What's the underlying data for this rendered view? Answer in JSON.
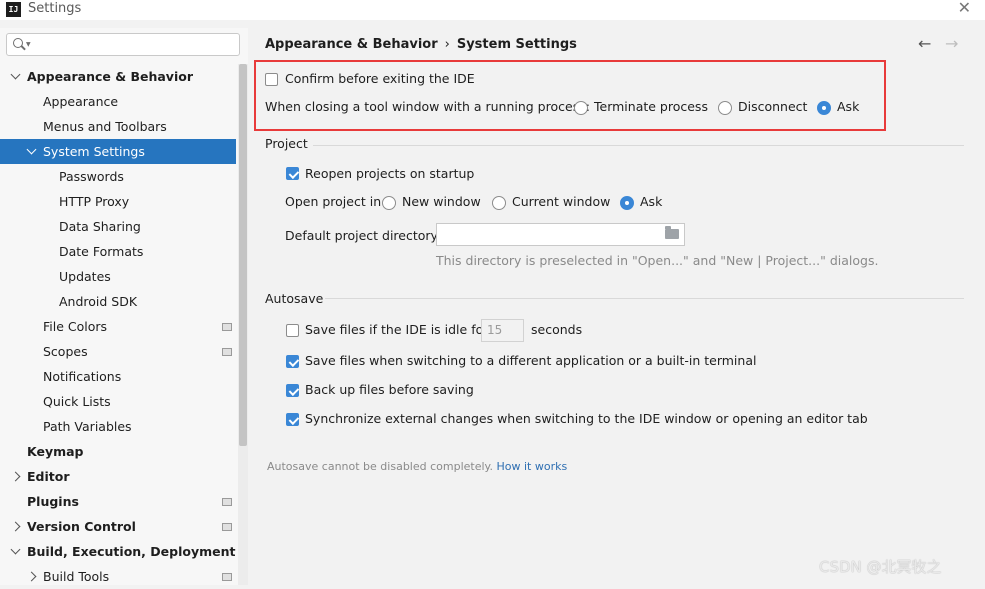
{
  "window": {
    "title": "Settings",
    "app_icon_label": "IJ"
  },
  "search": {
    "value": "",
    "placeholder": ""
  },
  "sidebar": {
    "items": [
      {
        "label": "Appearance & Behavior",
        "level": 0,
        "bold": true,
        "expanded": true,
        "selected": false,
        "project_icon": false
      },
      {
        "label": "Appearance",
        "level": 1,
        "bold": false,
        "selected": false,
        "project_icon": false
      },
      {
        "label": "Menus and Toolbars",
        "level": 1,
        "bold": false,
        "selected": false,
        "project_icon": false
      },
      {
        "label": "System Settings",
        "level": 1,
        "bold": false,
        "expanded": true,
        "selected": true,
        "project_icon": false
      },
      {
        "label": "Passwords",
        "level": 2,
        "bold": false,
        "selected": false,
        "project_icon": false
      },
      {
        "label": "HTTP Proxy",
        "level": 2,
        "bold": false,
        "selected": false,
        "project_icon": false
      },
      {
        "label": "Data Sharing",
        "level": 2,
        "bold": false,
        "selected": false,
        "project_icon": false
      },
      {
        "label": "Date Formats",
        "level": 2,
        "bold": false,
        "selected": false,
        "project_icon": false
      },
      {
        "label": "Updates",
        "level": 2,
        "bold": false,
        "selected": false,
        "project_icon": false
      },
      {
        "label": "Android SDK",
        "level": 2,
        "bold": false,
        "selected": false,
        "project_icon": false
      },
      {
        "label": "File Colors",
        "level": 1,
        "bold": false,
        "selected": false,
        "project_icon": true
      },
      {
        "label": "Scopes",
        "level": 1,
        "bold": false,
        "selected": false,
        "project_icon": true
      },
      {
        "label": "Notifications",
        "level": 1,
        "bold": false,
        "selected": false,
        "project_icon": false
      },
      {
        "label": "Quick Lists",
        "level": 1,
        "bold": false,
        "selected": false,
        "project_icon": false
      },
      {
        "label": "Path Variables",
        "level": 1,
        "bold": false,
        "selected": false,
        "project_icon": false
      },
      {
        "label": "Keymap",
        "level": 0,
        "bold": true,
        "selected": false,
        "project_icon": false
      },
      {
        "label": "Editor",
        "level": 0,
        "bold": true,
        "expanded": false,
        "selected": false,
        "project_icon": false
      },
      {
        "label": "Plugins",
        "level": 0,
        "bold": true,
        "selected": false,
        "project_icon": true
      },
      {
        "label": "Version Control",
        "level": 0,
        "bold": true,
        "expanded": false,
        "selected": false,
        "project_icon": true
      },
      {
        "label": "Build, Execution, Deployment",
        "level": 0,
        "bold": true,
        "expanded": true,
        "selected": false,
        "project_icon": false
      },
      {
        "label": "Build Tools",
        "level": 1,
        "bold": false,
        "expanded": false,
        "selected": false,
        "project_icon": true
      }
    ]
  },
  "breadcrumb": {
    "parent": "Appearance & Behavior",
    "separator": "›",
    "current": "System Settings"
  },
  "nav": {
    "back": "←",
    "forward": "→"
  },
  "general": {
    "confirm_exit_label": "Confirm before exiting the IDE",
    "confirm_exit_checked": false,
    "closing_label": "When closing a tool window with a running process:",
    "closing_options": [
      "Terminate process",
      "Disconnect",
      "Ask"
    ],
    "closing_selected": "Ask"
  },
  "project": {
    "section_title": "Project",
    "reopen_label": "Reopen projects on startup",
    "reopen_checked": true,
    "open_in_label": "Open project in",
    "open_in_options": [
      "New window",
      "Current window",
      "Ask"
    ],
    "open_in_selected": "Ask",
    "default_dir_label": "Default project directory:",
    "default_dir_value": "",
    "default_dir_hint": "This directory is preselected in \"Open...\" and \"New | Project...\" dialogs."
  },
  "autosave": {
    "section_title": "Autosave",
    "idle_label": "Save files if the IDE is idle for",
    "idle_checked": false,
    "idle_seconds": "15",
    "idle_unit": "seconds",
    "switch_app_label": "Save files when switching to a different application or a built-in terminal",
    "switch_app_checked": true,
    "backup_label": "Back up files before saving",
    "backup_checked": true,
    "sync_label": "Synchronize external changes when switching to the IDE window or opening an editor tab",
    "sync_checked": true,
    "note": "Autosave cannot be disabled completely.",
    "link": "How it works"
  },
  "watermark": "CSDN @北冥牧之"
}
